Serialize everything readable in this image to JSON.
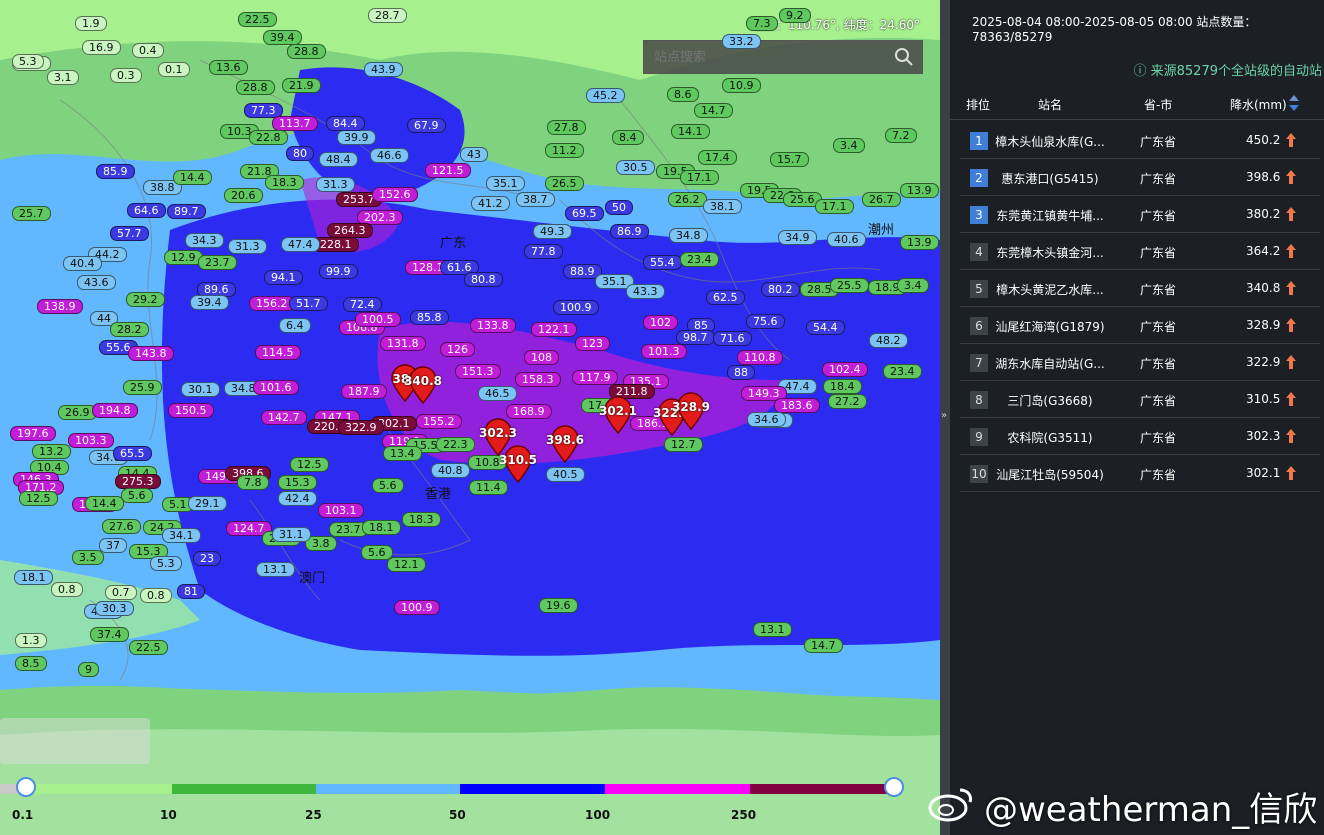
{
  "map": {
    "coord_text": "经度：110.76°, 纬度：24.60°",
    "search_placeholder": "站点搜索",
    "places": [
      {
        "name": "广东"
      },
      {
        "name": "香港"
      },
      {
        "name": "澳门"
      },
      {
        "name": "潮州"
      }
    ],
    "stations": [
      {
        "v": "1.9",
        "c": "c1"
      },
      {
        "v": "22.5",
        "c": "c2"
      },
      {
        "v": "28.7",
        "c": "c1"
      },
      {
        "v": "16.9",
        "c": "c1"
      },
      {
        "v": "0.4",
        "c": "c1"
      },
      {
        "v": "10.2",
        "c": "c1"
      },
      {
        "v": "5.3",
        "c": "c1"
      },
      {
        "v": "3.1",
        "c": "c1"
      },
      {
        "v": "0.3",
        "c": "c1"
      },
      {
        "v": "0.1",
        "c": "c1"
      },
      {
        "v": "39.4",
        "c": "c2"
      },
      {
        "v": "28.8",
        "c": "c2"
      },
      {
        "v": "13.6",
        "c": "c2"
      },
      {
        "v": "21.9",
        "c": "c2"
      },
      {
        "v": "28.8",
        "c": "c2"
      },
      {
        "v": "43.9",
        "c": "c3"
      },
      {
        "v": "77.3",
        "c": "c4"
      },
      {
        "v": "113.7",
        "c": "c5"
      },
      {
        "v": "10.3",
        "c": "c2"
      },
      {
        "v": "22.8",
        "c": "c2"
      },
      {
        "v": "80",
        "c": "c4"
      },
      {
        "v": "48.4",
        "c": "c3"
      },
      {
        "v": "39.9",
        "c": "c3"
      },
      {
        "v": "84.4",
        "c": "c4"
      },
      {
        "v": "46.6",
        "c": "c3"
      },
      {
        "v": "67.9",
        "c": "c4"
      },
      {
        "v": "121.5",
        "c": "c5"
      },
      {
        "v": "43",
        "c": "c3"
      },
      {
        "v": "27.8",
        "c": "c2"
      },
      {
        "v": "11.2",
        "c": "c2"
      },
      {
        "v": "8.4",
        "c": "c2"
      },
      {
        "v": "85.9",
        "c": "c4"
      },
      {
        "v": "38.8",
        "c": "c3"
      },
      {
        "v": "14.4",
        "c": "c2"
      },
      {
        "v": "20.6",
        "c": "c2"
      },
      {
        "v": "21.8",
        "c": "c2"
      },
      {
        "v": "18.3",
        "c": "c2"
      },
      {
        "v": "31.3",
        "c": "c3"
      },
      {
        "v": "253.7",
        "c": "c6"
      },
      {
        "v": "152.6",
        "c": "c5"
      },
      {
        "v": "202.3",
        "c": "c5"
      },
      {
        "v": "35.1",
        "c": "c3"
      },
      {
        "v": "41.2",
        "c": "c3"
      },
      {
        "v": "26.5",
        "c": "c2"
      },
      {
        "v": "38.7",
        "c": "c3"
      },
      {
        "v": "69.5",
        "c": "c4"
      },
      {
        "v": "50",
        "c": "c4"
      },
      {
        "v": "30.5",
        "c": "c3"
      },
      {
        "v": "19.5",
        "c": "c2"
      },
      {
        "v": "17.1",
        "c": "c2"
      },
      {
        "v": "17.4",
        "c": "c2"
      },
      {
        "v": "15.7",
        "c": "c2"
      },
      {
        "v": "19.5",
        "c": "c2"
      },
      {
        "v": "22.8",
        "c": "c2"
      },
      {
        "v": "3.4",
        "c": "c2"
      },
      {
        "v": "7.2",
        "c": "c2"
      },
      {
        "v": "13.9",
        "c": "c2"
      },
      {
        "v": "25.7",
        "c": "c2"
      },
      {
        "v": "64.6",
        "c": "c4"
      },
      {
        "v": "89.7",
        "c": "c4"
      },
      {
        "v": "228.1",
        "c": "c6"
      },
      {
        "v": "264.3",
        "c": "c6"
      },
      {
        "v": "49.3",
        "c": "c3"
      },
      {
        "v": "86.9",
        "c": "c4"
      },
      {
        "v": "26.2",
        "c": "c2"
      },
      {
        "v": "38.1",
        "c": "c3"
      },
      {
        "v": "25.6",
        "c": "c2"
      },
      {
        "v": "17.1",
        "c": "c2"
      },
      {
        "v": "26.7",
        "c": "c2"
      },
      {
        "v": "57.7",
        "c": "c4"
      },
      {
        "v": "34.3",
        "c": "c3"
      },
      {
        "v": "31.3",
        "c": "c3"
      },
      {
        "v": "47.4",
        "c": "c3"
      },
      {
        "v": "77.8",
        "c": "c4"
      },
      {
        "v": "34.8",
        "c": "c3"
      },
      {
        "v": "34.9",
        "c": "c3"
      },
      {
        "v": "40.6",
        "c": "c3"
      },
      {
        "v": "13.9",
        "c": "c2"
      },
      {
        "v": "44.2",
        "c": "c3"
      },
      {
        "v": "12.9",
        "c": "c2"
      },
      {
        "v": "23.7",
        "c": "c2"
      },
      {
        "v": "128.1",
        "c": "c5"
      },
      {
        "v": "61.6",
        "c": "c4"
      },
      {
        "v": "88.9",
        "c": "c4"
      },
      {
        "v": "55.4",
        "c": "c4"
      },
      {
        "v": "23.4",
        "c": "c2"
      },
      {
        "v": "40.4",
        "c": "c3"
      },
      {
        "v": "43.6",
        "c": "c3"
      },
      {
        "v": "94.1",
        "c": "c4"
      },
      {
        "v": "99.9",
        "c": "c4"
      },
      {
        "v": "80.8",
        "c": "c4"
      },
      {
        "v": "35.1",
        "c": "c3"
      },
      {
        "v": "43.3",
        "c": "c3"
      },
      {
        "v": "62.5",
        "c": "c4"
      },
      {
        "v": "80.2",
        "c": "c4"
      },
      {
        "v": "28.5",
        "c": "c2"
      },
      {
        "v": "25.5",
        "c": "c2"
      },
      {
        "v": "18.9",
        "c": "c2"
      },
      {
        "v": "3.4",
        "c": "c2"
      },
      {
        "v": "29.2",
        "c": "c2"
      },
      {
        "v": "89.6",
        "c": "c4"
      },
      {
        "v": "138.9",
        "c": "c5"
      },
      {
        "v": "39.4",
        "c": "c3"
      },
      {
        "v": "156.2",
        "c": "c5"
      },
      {
        "v": "51.7",
        "c": "c4"
      },
      {
        "v": "72.4",
        "c": "c4"
      },
      {
        "v": "85.8",
        "c": "c4"
      },
      {
        "v": "133.8",
        "c": "c5"
      },
      {
        "v": "100.9",
        "c": "c4"
      },
      {
        "v": "102",
        "c": "c5"
      },
      {
        "v": "85",
        "c": "c4"
      },
      {
        "v": "75.6",
        "c": "c4"
      },
      {
        "v": "54.4",
        "c": "c4"
      },
      {
        "v": "44",
        "c": "c3"
      },
      {
        "v": "28.2",
        "c": "c2"
      },
      {
        "v": "6.4",
        "c": "c3"
      },
      {
        "v": "106.8",
        "c": "c5"
      },
      {
        "v": "100.5",
        "c": "c5"
      },
      {
        "v": "122.1",
        "c": "c5"
      },
      {
        "v": "123",
        "c": "c5"
      },
      {
        "v": "101.3",
        "c": "c5"
      },
      {
        "v": "98.7",
        "c": "c4"
      },
      {
        "v": "48.2",
        "c": "c3"
      },
      {
        "v": "55.6",
        "c": "c4"
      },
      {
        "v": "143.8",
        "c": "c5"
      },
      {
        "v": "114.5",
        "c": "c5"
      },
      {
        "v": "131.8",
        "c": "c5"
      },
      {
        "v": "126",
        "c": "c5"
      },
      {
        "v": "108",
        "c": "c5"
      },
      {
        "v": "71.6",
        "c": "c4"
      },
      {
        "v": "110.8",
        "c": "c5"
      },
      {
        "v": "102.4",
        "c": "c5"
      },
      {
        "v": "23.4",
        "c": "c2"
      },
      {
        "v": "25.9",
        "c": "c2"
      },
      {
        "v": "30.1",
        "c": "c3"
      },
      {
        "v": "34.8",
        "c": "c3"
      },
      {
        "v": "101.6",
        "c": "c5"
      },
      {
        "v": "187.9",
        "c": "c5"
      },
      {
        "v": "151.3",
        "c": "c5"
      },
      {
        "v": "158.3",
        "c": "c5"
      },
      {
        "v": "117.9",
        "c": "c5"
      },
      {
        "v": "135.1",
        "c": "c5"
      },
      {
        "v": "88",
        "c": "c4"
      },
      {
        "v": "47.4",
        "c": "c3"
      },
      {
        "v": "18.4",
        "c": "c2"
      },
      {
        "v": "27.2",
        "c": "c2"
      },
      {
        "v": "26.9",
        "c": "c2"
      },
      {
        "v": "194.8",
        "c": "c5"
      },
      {
        "v": "150.5",
        "c": "c5"
      },
      {
        "v": "142.7",
        "c": "c5"
      },
      {
        "v": "147.1",
        "c": "c5"
      },
      {
        "v": "46.5",
        "c": "c3"
      },
      {
        "v": "211.8",
        "c": "c6"
      },
      {
        "v": "149.3",
        "c": "c5"
      },
      {
        "v": "183.6",
        "c": "c5"
      },
      {
        "v": "155.2",
        "c": "c5"
      },
      {
        "v": "168.9",
        "c": "c5"
      },
      {
        "v": "17.9",
        "c": "c2"
      },
      {
        "v": "30.1",
        "c": "c3"
      },
      {
        "v": "34.6",
        "c": "c3"
      },
      {
        "v": "197.6",
        "c": "c5"
      },
      {
        "v": "103.3",
        "c": "c5"
      },
      {
        "v": "220.6",
        "c": "c6"
      },
      {
        "v": "302.1",
        "c": "c6"
      },
      {
        "v": "322.9",
        "c": "c6"
      },
      {
        "v": "119.1",
        "c": "c5"
      },
      {
        "v": "186.9",
        "c": "c5"
      },
      {
        "v": "12.7",
        "c": "c2"
      },
      {
        "v": "15.5",
        "c": "c2"
      },
      {
        "v": "22.3",
        "c": "c2"
      },
      {
        "v": "13.2",
        "c": "c2"
      },
      {
        "v": "10.4",
        "c": "c2"
      },
      {
        "v": "14.4",
        "c": "c2"
      },
      {
        "v": "34.6",
        "c": "c3"
      },
      {
        "v": "65.5",
        "c": "c4"
      },
      {
        "v": "149.9",
        "c": "c5"
      },
      {
        "v": "398.6",
        "c": "c6"
      },
      {
        "v": "12.5",
        "c": "c2"
      },
      {
        "v": "13.4",
        "c": "c2"
      },
      {
        "v": "10.8",
        "c": "c2"
      },
      {
        "v": "40.5",
        "c": "c3"
      },
      {
        "v": "146.3",
        "c": "c5"
      },
      {
        "v": "171.2",
        "c": "c5"
      },
      {
        "v": "275.3",
        "c": "c6"
      },
      {
        "v": "5.6",
        "c": "c2"
      },
      {
        "v": "7.8",
        "c": "c2"
      },
      {
        "v": "15.3",
        "c": "c2"
      },
      {
        "v": "5.6",
        "c": "c2"
      },
      {
        "v": "40.8",
        "c": "c3"
      },
      {
        "v": "11.4",
        "c": "c2"
      },
      {
        "v": "12.5",
        "c": "c2"
      },
      {
        "v": "125.1",
        "c": "c5"
      },
      {
        "v": "14.4",
        "c": "c2"
      },
      {
        "v": "5.1",
        "c": "c2"
      },
      {
        "v": "29.1",
        "c": "c3"
      },
      {
        "v": "42.4",
        "c": "c3"
      },
      {
        "v": "103.1",
        "c": "c5"
      },
      {
        "v": "18.3",
        "c": "c2"
      },
      {
        "v": "27.6",
        "c": "c2"
      },
      {
        "v": "24.2",
        "c": "c2"
      },
      {
        "v": "34.1",
        "c": "c3"
      },
      {
        "v": "124.7",
        "c": "c5"
      },
      {
        "v": "21.2",
        "c": "c2"
      },
      {
        "v": "3.8",
        "c": "c2"
      },
      {
        "v": "31.1",
        "c": "c3"
      },
      {
        "v": "23.7",
        "c": "c2"
      },
      {
        "v": "18.1",
        "c": "c2"
      },
      {
        "v": "37",
        "c": "c3"
      },
      {
        "v": "3.5",
        "c": "c2"
      },
      {
        "v": "15.3",
        "c": "c2"
      },
      {
        "v": "5.3",
        "c": "c3"
      },
      {
        "v": "23",
        "c": "c4"
      },
      {
        "v": "5.6",
        "c": "c2"
      },
      {
        "v": "12.1",
        "c": "c2"
      },
      {
        "v": "18.1",
        "c": "c3"
      },
      {
        "v": "13.1",
        "c": "c3"
      },
      {
        "v": "0.8",
        "c": "c1"
      },
      {
        "v": "0.7",
        "c": "c1"
      },
      {
        "v": "0.8",
        "c": "c1"
      },
      {
        "v": "81",
        "c": "c4"
      },
      {
        "v": "45.7",
        "c": "c3"
      },
      {
        "v": "30.3",
        "c": "c3"
      },
      {
        "v": "100.9",
        "c": "c5"
      },
      {
        "v": "19.6",
        "c": "c2"
      },
      {
        "v": "37.4",
        "c": "c2"
      },
      {
        "v": "22.5",
        "c": "c2"
      },
      {
        "v": "13.1",
        "c": "c2"
      },
      {
        "v": "14.7",
        "c": "c2"
      },
      {
        "v": "1.3",
        "c": "c1"
      },
      {
        "v": "8.5",
        "c": "c2"
      },
      {
        "v": "9",
        "c": "c2"
      },
      {
        "v": "14.7",
        "c": "c2"
      },
      {
        "v": "14.1",
        "c": "c2"
      },
      {
        "v": "8.6",
        "c": "c2"
      },
      {
        "v": "10.9",
        "c": "c2"
      },
      {
        "v": "45.2",
        "c": "c3"
      },
      {
        "v": "9.2",
        "c": "c2"
      },
      {
        "v": "7.3",
        "c": "c2"
      },
      {
        "v": "33.2",
        "c": "c3"
      }
    ],
    "markers": [
      {
        "v": "383"
      },
      {
        "v": "340.8"
      },
      {
        "v": "302.3"
      },
      {
        "v": "310.5"
      },
      {
        "v": "398.6"
      },
      {
        "v": "302.1"
      },
      {
        "v": "322.9"
      },
      {
        "v": "328.9"
      }
    ]
  },
  "legend": {
    "ticks": [
      "0.1",
      "10",
      "25",
      "50",
      "100",
      "250"
    ],
    "colors": [
      "#c8c8c8",
      "#a6f08e",
      "#3db83d",
      "#61b8ff",
      "#0000ff",
      "#fa00fa",
      "#800040"
    ]
  },
  "panel": {
    "range_text": "2025-08-04 08:00-2025-08-05 08:00  站点数量：78363/85279",
    "source_text": "ⓘ 来源85279个全站级的自动站",
    "headers": {
      "rank": "排位",
      "name": "站名",
      "province": "省-市",
      "precip": "降水(mm)"
    },
    "rows": [
      {
        "rank": "1",
        "name": "樟木头仙泉水库(G...",
        "province": "广东省",
        "value": "450.2"
      },
      {
        "rank": "2",
        "name": "惠东港口(G5415)",
        "province": "广东省",
        "value": "398.6"
      },
      {
        "rank": "3",
        "name": "东莞黄江镇黄牛埔...",
        "province": "广东省",
        "value": "380.2"
      },
      {
        "rank": "4",
        "name": "东莞樟木头镇金河...",
        "province": "广东省",
        "value": "364.2"
      },
      {
        "rank": "5",
        "name": "樟木头黄泥乙水库...",
        "province": "广东省",
        "value": "340.8"
      },
      {
        "rank": "6",
        "name": "汕尾红海湾(G1879)",
        "province": "广东省",
        "value": "328.9"
      },
      {
        "rank": "7",
        "name": "湖东水库自动站(G...",
        "province": "广东省",
        "value": "322.9"
      },
      {
        "rank": "8",
        "name": "三门岛(G3668)",
        "province": "广东省",
        "value": "310.5"
      },
      {
        "rank": "9",
        "name": "农科院(G3511)",
        "province": "广东省",
        "value": "302.3"
      },
      {
        "rank": "10",
        "name": "汕尾江牡岛(59504)",
        "province": "广东省",
        "value": "302.1"
      }
    ]
  },
  "watermark": "@weatherman_信欣"
}
